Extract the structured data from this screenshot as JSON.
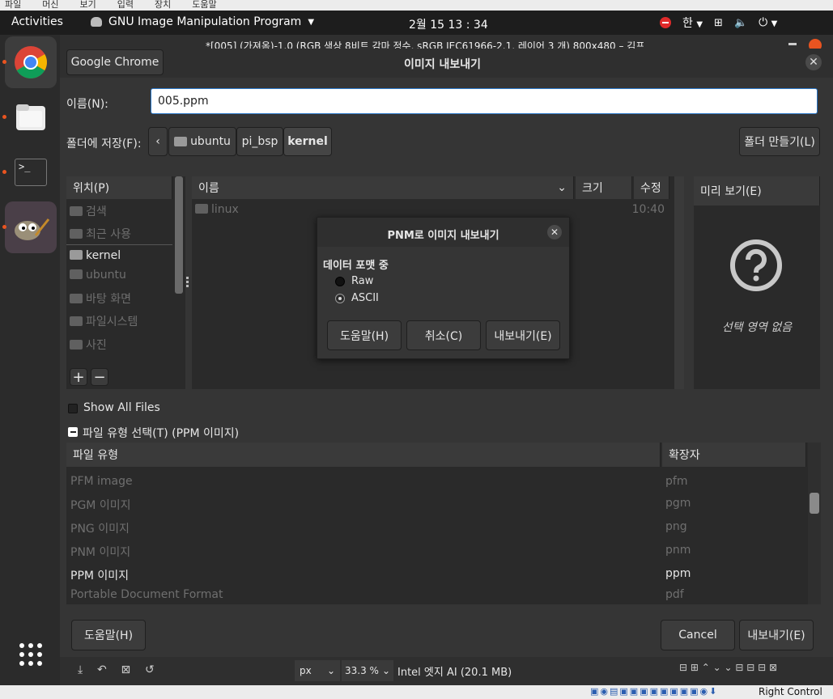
{
  "vm_menu": [
    "파일",
    "머신",
    "보기",
    "입력",
    "장치",
    "도움말"
  ],
  "topbar": {
    "activities": "Activities",
    "app_name": "GNU Image Manipulation Program",
    "clock": "2월 15  13 : 34",
    "lang": "한"
  },
  "gimp_title": "*[005] (가져옴)-1.0 (RGB 색상 8비트 감마 정수, sRGB IEC61966-2.1, 레이어 3 개) 800x480 – 김프",
  "dialog": {
    "chrome_tab": "Google Chrome",
    "title": "이미지 내보내기",
    "name_label": "이름(N):",
    "name_value": "005.ppm",
    "save_in_label": "폴더에 저장(F):",
    "path": [
      "ubuntu",
      "pi_bsp",
      "kernel"
    ],
    "create_folder": "폴더 만들기(L)",
    "places_header": "위치(P)",
    "places": [
      {
        "label": "검색",
        "dim": true
      },
      {
        "label": "최근 사용",
        "dim": true
      },
      {
        "label": "kernel",
        "dim": false
      },
      {
        "label": "ubuntu",
        "dim": true
      },
      {
        "label": "바탕 화면",
        "dim": true
      },
      {
        "label": "파일시스템",
        "dim": true
      },
      {
        "label": "사진",
        "dim": true
      }
    ],
    "files_columns": [
      "이름",
      "크기",
      "수정"
    ],
    "files": [
      {
        "name": "linux",
        "size": "",
        "modified": "10:40"
      }
    ],
    "preview_header": "미리 보기(E)",
    "preview_empty": "선택 영역 없음",
    "show_all_files": "Show All Files",
    "file_type_toggle": "파일 유형 선택(T) (PPM 이미지)",
    "type_columns": [
      "파일 유형",
      "확장자"
    ],
    "types": [
      {
        "name": "PFM image",
        "ext": "pfm",
        "dim": true
      },
      {
        "name": "PGM 이미지",
        "ext": "pgm",
        "dim": true
      },
      {
        "name": "PNG 이미지",
        "ext": "png",
        "dim": true
      },
      {
        "name": "PNM 이미지",
        "ext": "pnm",
        "dim": true
      },
      {
        "name": "PPM 이미지",
        "ext": "ppm",
        "dim": false
      },
      {
        "name": "Portable Document Format",
        "ext": "pdf",
        "dim": true
      }
    ],
    "help_button": "도움말(H)",
    "cancel_button": "Cancel",
    "export_button": "내보내기(E)"
  },
  "pnm_dialog": {
    "title": "PNM로 이미지 내보내기",
    "section": "데이터 포맷 중",
    "options": [
      {
        "label": "Raw",
        "selected": false
      },
      {
        "label": "ASCII",
        "selected": true
      }
    ],
    "help": "도움말(H)",
    "cancel": "취소(C)",
    "export": "내보내기(E)"
  },
  "gimp_status": {
    "unit": "px",
    "zoom": "33.3 %",
    "info": "Intel 엣지 AI (20.1 MB)"
  },
  "vm_status": {
    "host_key": "Right Control"
  },
  "colors": {
    "accent": "#e95420",
    "bg": "#353535",
    "panel": "#2a2a2a"
  }
}
